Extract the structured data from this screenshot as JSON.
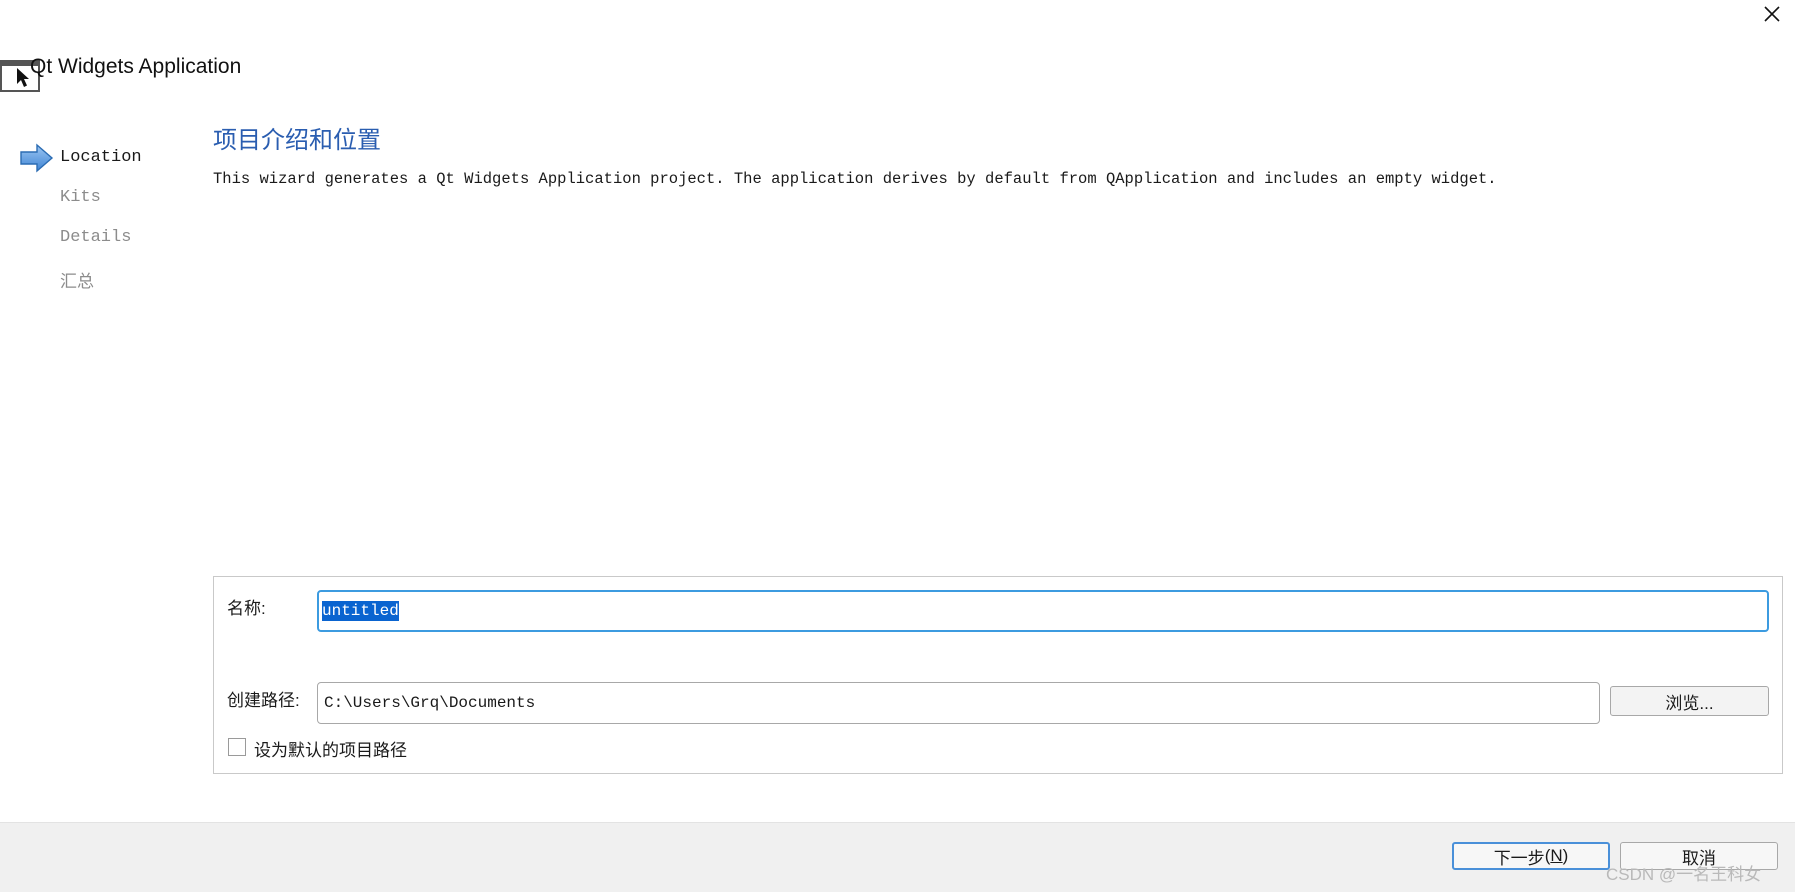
{
  "window": {
    "title": "Qt Widgets Application",
    "icon": "app-window-cursor-icon",
    "close_icon": "close-icon"
  },
  "steps": {
    "items": [
      {
        "label": "Location",
        "active": true
      },
      {
        "label": "Kits",
        "active": false
      },
      {
        "label": "Details",
        "active": false
      },
      {
        "label": "汇总",
        "active": false
      }
    ],
    "current_indicator_icon": "arrow-right-icon"
  },
  "page": {
    "heading": "项目介绍和位置",
    "description": "This wizard generates a Qt Widgets Application project. The application derives by default from QApplication and includes an empty widget."
  },
  "form": {
    "name_label": "名称:",
    "name_value": "untitled",
    "path_label": "创建路径:",
    "path_value": "C:\\Users\\Grq\\Documents",
    "browse_label": "浏览...",
    "default_path_checkbox_label": "设为默认的项目路径",
    "default_path_checked": false
  },
  "footer": {
    "next_label": "下一步",
    "next_shortcut": "N",
    "cancel_label": "取消"
  },
  "watermark": "CSDN @一名王科女",
  "colors": {
    "heading": "#2a5db0",
    "focus_border": "#3c9be0",
    "selection": "#0a64d0",
    "footer_bg": "#f0f0f0",
    "inactive_step": "#8c8c8c"
  }
}
